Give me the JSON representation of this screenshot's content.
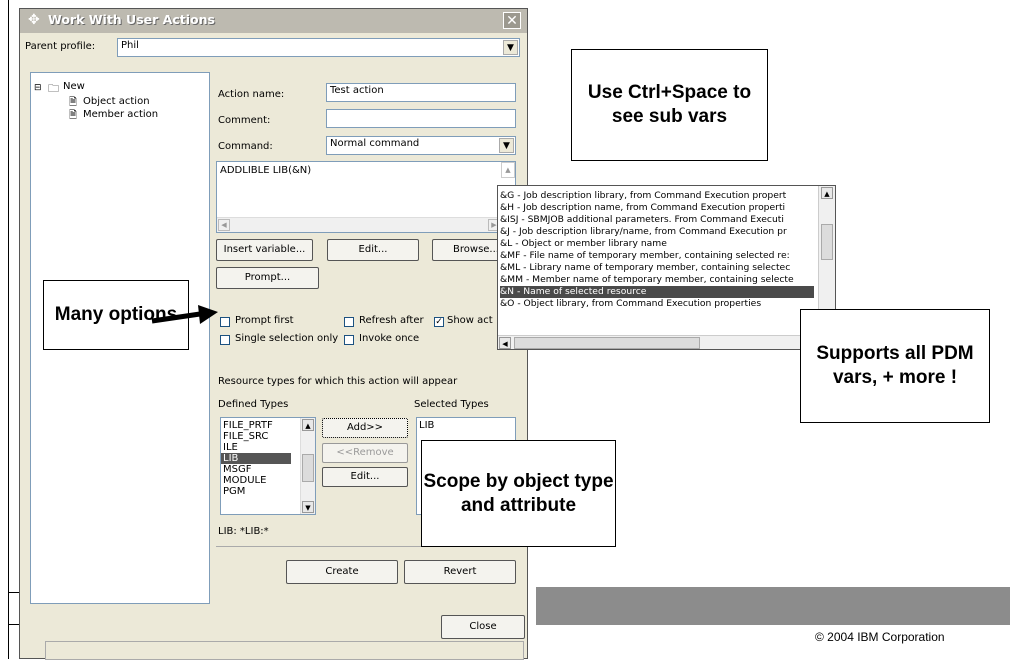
{
  "dialog": {
    "title": "Work With User Actions",
    "close_glyph": "✕",
    "parent_profile_label": "Parent profile:",
    "parent_profile_value": "Phil",
    "tree": {
      "root": "New",
      "items": [
        "Object action",
        "Member action"
      ]
    },
    "action_name_label": "Action name:",
    "action_name_value": "Test action",
    "comment_label": "Comment:",
    "comment_value": "",
    "command_label": "Command:",
    "command_value": "Normal command",
    "command_text": "ADDLIBLE LIB(&N)",
    "buttons": {
      "insert_variable": "Insert variable...",
      "edit": "Edit...",
      "browse": "Browse...",
      "prompt": "Prompt...",
      "add": "Add>>",
      "remove": "<<Remove",
      "edit2": "Edit...",
      "create": "Create",
      "revert": "Revert",
      "close": "Close"
    },
    "checkboxes": {
      "prompt_first": "Prompt first",
      "refresh_after": "Refresh after",
      "show_action": "Show act",
      "single_selection": "Single selection only",
      "invoke_once": "Invoke once"
    },
    "resource_types_label": "Resource types for which this action will appear",
    "defined_types_label": "Defined Types",
    "selected_types_label": "Selected Types",
    "defined_types": [
      "FILE_PRTF",
      "FILE_SRC",
      "ILE",
      "LIB",
      "MSGF",
      "MODULE",
      "PGM"
    ],
    "defined_types_selected": "LIB",
    "selected_types": [
      "LIB"
    ],
    "type_filter": "LIB: *LIB:*"
  },
  "popup": {
    "items": [
      "&G - Job description library, from Command Execution propert",
      "&H - Job description name, from Command Execution properti",
      "&ISJ - SBMJOB additional parameters. From Command Executi",
      "&J - Job description library/name, from Command Execution pr",
      "&L - Object or member library name",
      "&MF - File name of temporary member, containing selected re:",
      "&ML - Library name of temporary member, containing selectec",
      "&MM - Member name of temporary member, containing selecte",
      "&N - Name of selected resource",
      "&O - Object library, from Command Execution properties"
    ],
    "selected": "&N - Name of selected resource"
  },
  "callouts": {
    "ctrl_space": "Use Ctrl+Space to see sub vars",
    "many_options": "Many options",
    "supports_all": "Supports all PDM vars, + more !",
    "scope": "Scope by object type and attribute"
  },
  "footer": {
    "copyright": "© 2004 IBM Corporation"
  },
  "colors": {
    "gray_bar": "#8c8c8c",
    "title_bar": "#bdbab0",
    "selection": "#4a4a4a"
  }
}
